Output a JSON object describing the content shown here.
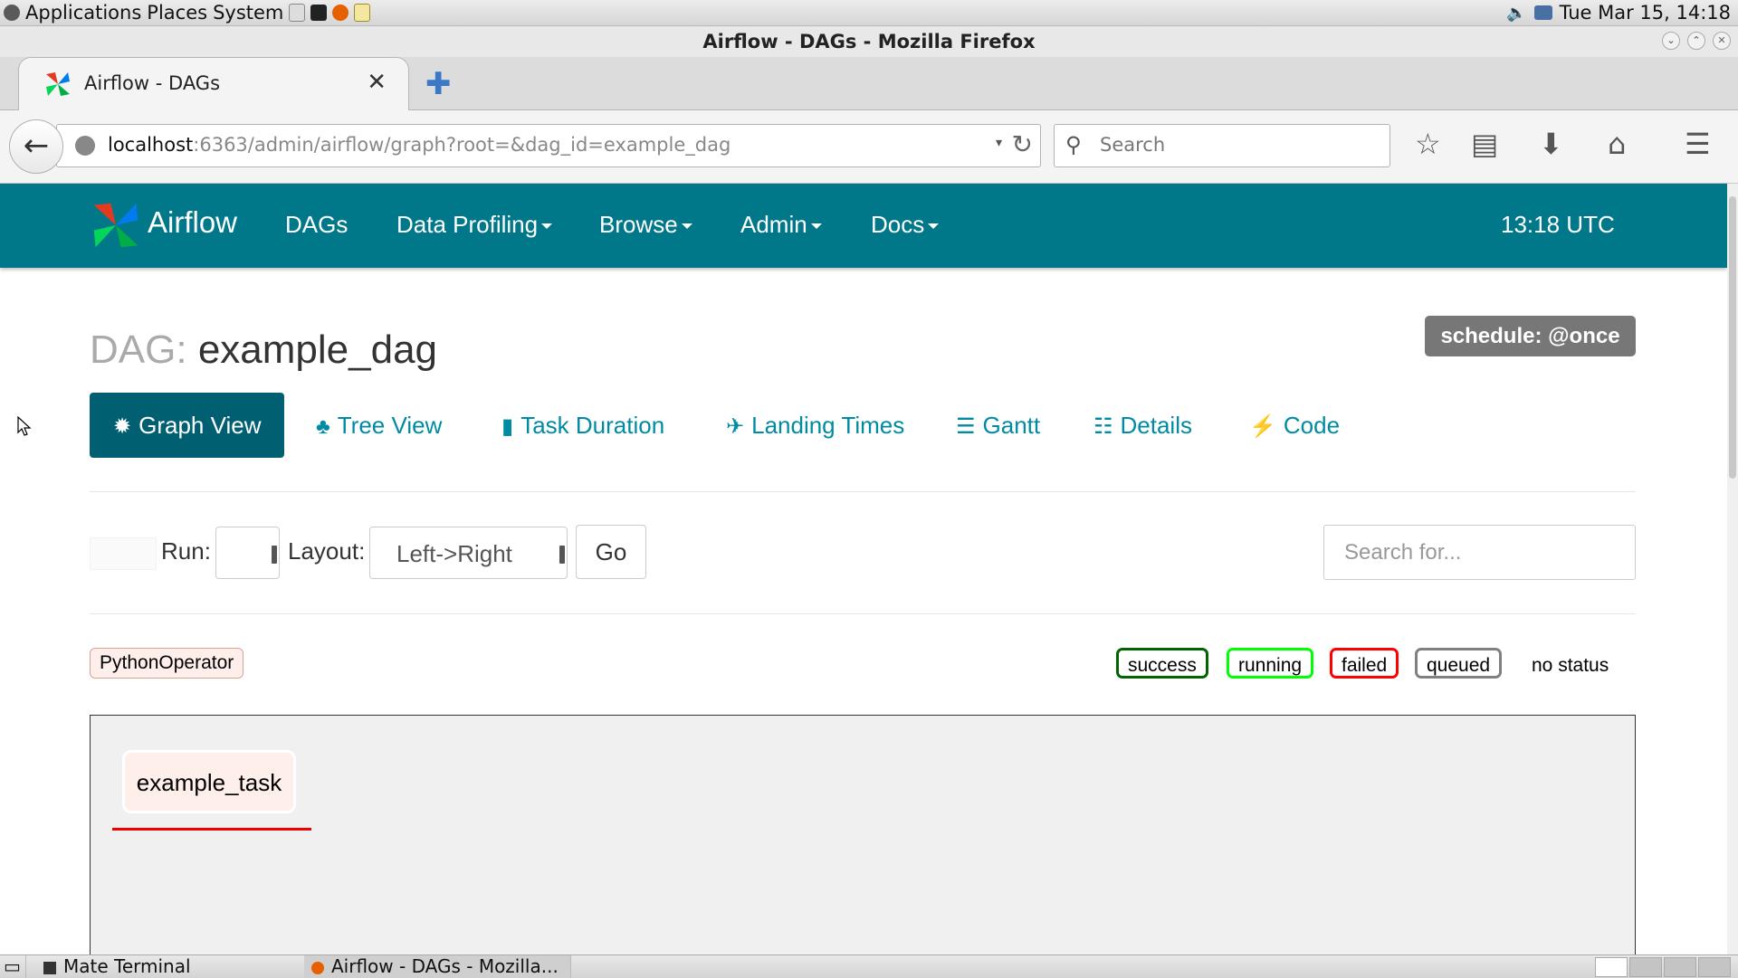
{
  "system": {
    "menus": [
      "Applications",
      "Places",
      "System"
    ],
    "clock": "Tue Mar 15, 14:18"
  },
  "window": {
    "title": "Airflow - DAGs - Mozilla Firefox"
  },
  "browser": {
    "tab_title": "Airflow - DAGs",
    "tab_close": "✕",
    "new_tab": "✚",
    "url_host": "localhost",
    "url_rest": ":6363/admin/airflow/graph?root=&dag_id=example_dag",
    "search_placeholder": "Search"
  },
  "airflow": {
    "brand": "Airflow",
    "nav": [
      {
        "label": "DAGs",
        "dropdown": false
      },
      {
        "label": "Data Profiling",
        "dropdown": true
      },
      {
        "label": "Browse",
        "dropdown": true
      },
      {
        "label": "Admin",
        "dropdown": true
      },
      {
        "label": "Docs",
        "dropdown": true
      }
    ],
    "clock": "13:18 UTC"
  },
  "dag": {
    "prefix": "DAG:",
    "name": "example_dag",
    "schedule": "schedule: @once"
  },
  "view_tabs": [
    {
      "label": "Graph View",
      "icon": "asterisk-icon",
      "glyph": "✹"
    },
    {
      "label": "Tree View",
      "icon": "tree-icon",
      "glyph": "♣"
    },
    {
      "label": "Task Duration",
      "icon": "bar-chart-icon",
      "glyph": "▮"
    },
    {
      "label": "Landing Times",
      "icon": "plane-icon",
      "glyph": "✈"
    },
    {
      "label": "Gantt",
      "icon": "align-left-icon",
      "glyph": "☰"
    },
    {
      "label": "Details",
      "icon": "list-icon",
      "glyph": "☷"
    },
    {
      "label": "Code",
      "icon": "flash-icon",
      "glyph": "⚡"
    }
  ],
  "controls": {
    "run_label": "Run:",
    "run_value": "",
    "layout_label": "Layout:",
    "layout_value": "Left->Right",
    "go_label": "Go",
    "search_placeholder": "Search for..."
  },
  "operators": [
    "PythonOperator"
  ],
  "legend": [
    {
      "label": "success",
      "color": "#006400"
    },
    {
      "label": "running",
      "color": "#00ff00"
    },
    {
      "label": "failed",
      "color": "#ff0000"
    },
    {
      "label": "queued",
      "color": "#808080"
    },
    {
      "label": "no status",
      "color": "#ffffff"
    }
  ],
  "graph": {
    "tasks": [
      "example_task"
    ]
  },
  "taskbar": {
    "items": [
      "Mate Terminal",
      "Airflow - DAGs - Mozilla..."
    ]
  }
}
